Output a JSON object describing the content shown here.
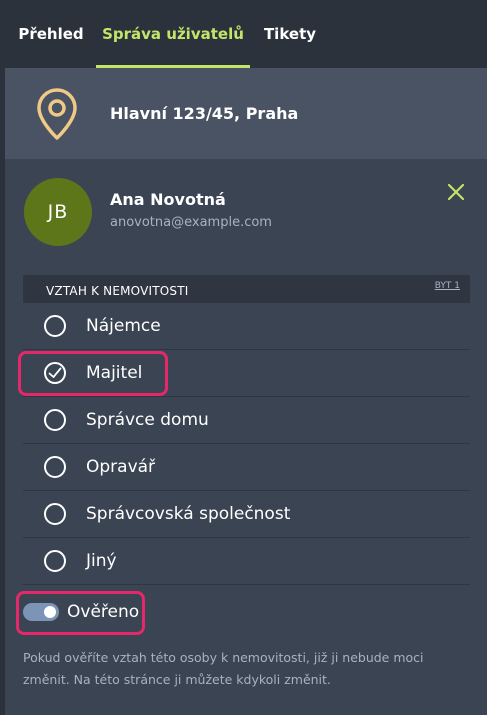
{
  "nav": {
    "tabs": [
      {
        "label": "Přehled",
        "active": false
      },
      {
        "label": "Správa uživatelů",
        "active": true
      },
      {
        "label": "Tikety",
        "active": false
      }
    ]
  },
  "property": {
    "icon": "location-pin-icon",
    "address": "Hlavní 123/45, Praha"
  },
  "user": {
    "initials": "JB",
    "name": "Ana Novotná",
    "email": "anovotna@example.com",
    "close_icon": "close-icon"
  },
  "relationship": {
    "title": "VZTAH K NEMOVITOSTI",
    "unit_link": "BYT 1",
    "options": [
      {
        "label": "Nájemce",
        "selected": false
      },
      {
        "label": "Majitel",
        "selected": true
      },
      {
        "label": "Správce domu",
        "selected": false
      },
      {
        "label": "Opravář",
        "selected": false
      },
      {
        "label": "Správcovská společnost",
        "selected": false
      },
      {
        "label": "Jiný",
        "selected": false
      }
    ]
  },
  "verified": {
    "label": "Ověřeno",
    "on": true
  },
  "note": "Pokud ověříte vztah této osoby k nemovitosti, již ji nebude moci změnit. Na této stránce ji můžete kdykoli změnit.",
  "colors": {
    "accent": "#c3e66a",
    "highlight": "#e5286a",
    "avatar": "#5d7619",
    "toggle": "#7c95b7"
  }
}
